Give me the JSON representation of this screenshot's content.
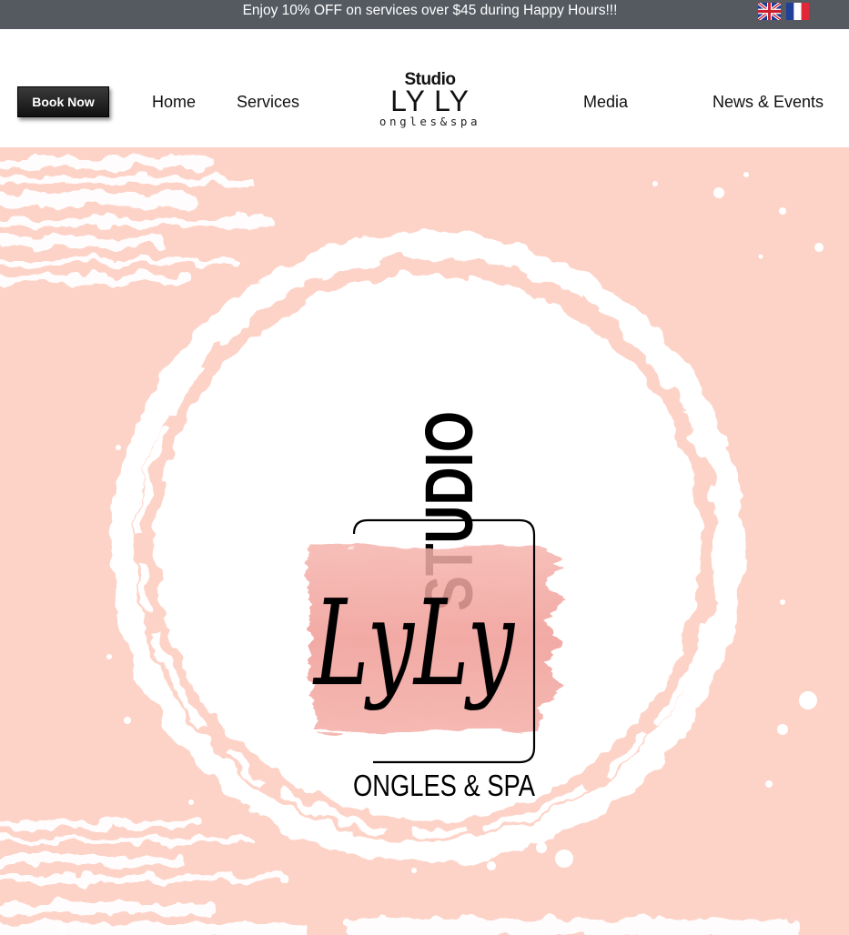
{
  "promo": {
    "text": "Enjoy 10% OFF on services over $45 during Happy Hours!!!"
  },
  "languages": [
    {
      "name": "uk-flag-icon"
    },
    {
      "name": "fr-flag-icon"
    }
  ],
  "header": {
    "book_label": "Book Now",
    "nav": {
      "home": "Home",
      "services": "Services",
      "media": "Media",
      "news": "News & Events"
    },
    "logo": {
      "line1": "Studio",
      "line2": "LY LY",
      "line3": "ongles&spa"
    }
  },
  "hero": {
    "logo_studio": "STUDIO",
    "logo_script": "LyLy",
    "logo_tagline": "ONGLES & SPA"
  },
  "colors": {
    "promo_bg": "#555a61",
    "hero_bg": "#fdd3c8",
    "accent_watercolor": "#f2a29c",
    "button_bg": "#1a1a1a"
  }
}
